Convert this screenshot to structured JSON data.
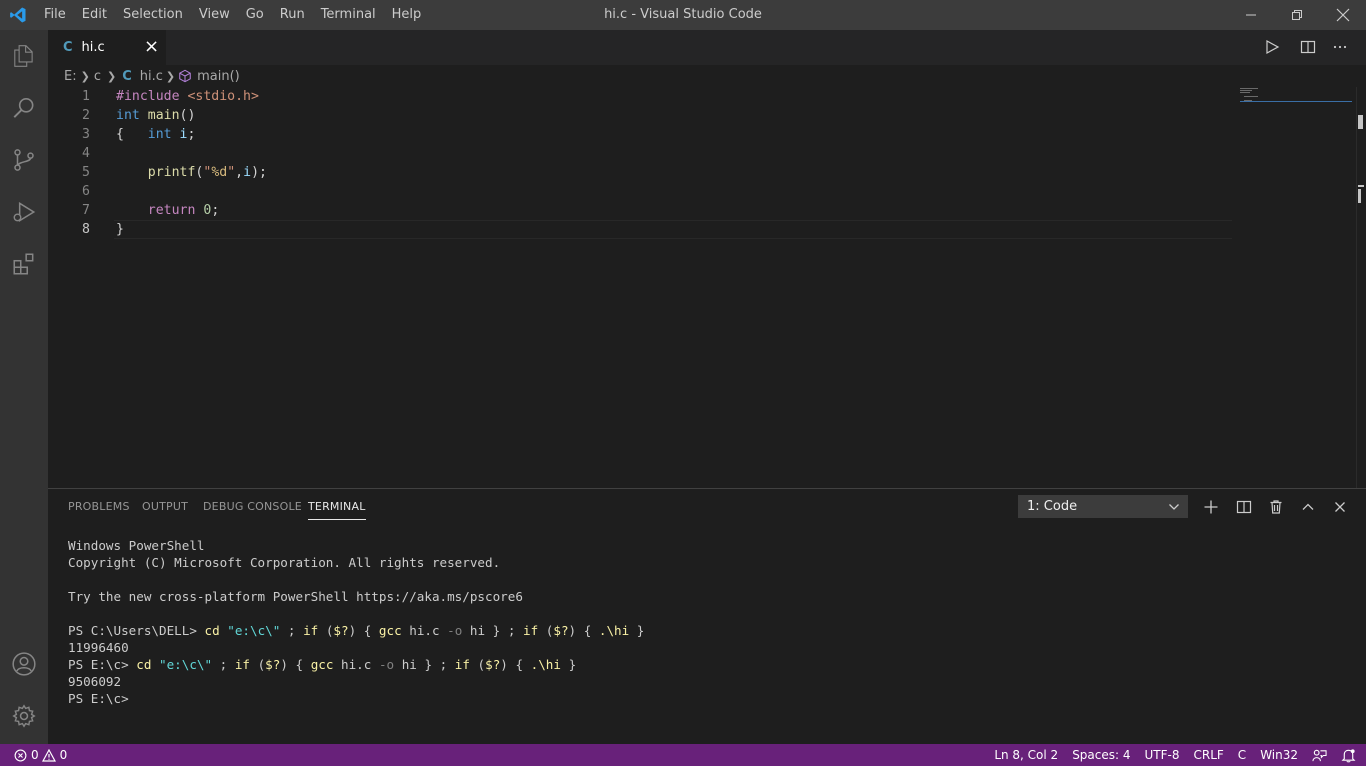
{
  "window": {
    "title": "hi.c - Visual Studio Code",
    "menu": [
      "File",
      "Edit",
      "Selection",
      "View",
      "Go",
      "Run",
      "Terminal",
      "Help"
    ]
  },
  "activity_bar": {
    "icons": [
      "explorer-icon",
      "search-icon",
      "source-control-icon",
      "run-debug-icon",
      "extensions-icon"
    ],
    "bottom_icons": [
      "account-icon",
      "settings-gear-icon"
    ]
  },
  "tabs": [
    {
      "lang_icon": "C",
      "label": "hi.c",
      "close": "×"
    }
  ],
  "breadcrumb": {
    "drive": "E:",
    "folder": "c",
    "file_icon": "C",
    "file": "hi.c",
    "symbol": "main()"
  },
  "editor": {
    "lines": [
      {
        "n": "1",
        "parts": [
          [
            "pp",
            "#include "
          ],
          [
            "str",
            "<stdio.h>"
          ]
        ]
      },
      {
        "n": "2",
        "parts": [
          [
            "kw",
            "int"
          ],
          [
            "",
            " "
          ],
          [
            "fn",
            "main"
          ],
          [
            "",
            "()"
          ]
        ]
      },
      {
        "n": "3",
        "parts": [
          [
            "",
            "{   "
          ],
          [
            "kw",
            "int"
          ],
          [
            "",
            " "
          ],
          [
            "var",
            "i"
          ],
          [
            "",
            ";"
          ]
        ]
      },
      {
        "n": "4",
        "parts": []
      },
      {
        "n": "5",
        "parts": [
          [
            "",
            "    "
          ],
          [
            "fn",
            "printf"
          ],
          [
            "",
            "("
          ],
          [
            "str",
            "\""
          ],
          [
            "ctr",
            "%d"
          ],
          [
            "str",
            "\""
          ],
          [
            "",
            ","
          ],
          [
            "var",
            "i"
          ],
          [
            "",
            ");"
          ]
        ]
      },
      {
        "n": "6",
        "parts": []
      },
      {
        "n": "7",
        "parts": [
          [
            "",
            "    "
          ],
          [
            "kwc",
            "return"
          ],
          [
            "",
            " "
          ],
          [
            "num",
            "0"
          ],
          [
            "",
            ";"
          ]
        ]
      },
      {
        "n": "8",
        "parts": [
          [
            "",
            "}"
          ]
        ]
      }
    ]
  },
  "panel": {
    "tabs": [
      "PROBLEMS",
      "OUTPUT",
      "DEBUG CONSOLE",
      "TERMINAL"
    ],
    "active_tab": "TERMINAL",
    "terminal_select": "1: Code",
    "terminal_lines": [
      [
        [
          "t-w",
          "Windows PowerShell"
        ]
      ],
      [
        [
          "t-w",
          "Copyright (C) Microsoft Corporation. All rights reserved."
        ]
      ],
      [],
      [
        [
          "t-w",
          "Try the new cross-platform PowerShell https://aka.ms/pscore6"
        ]
      ],
      [],
      [
        [
          "t-w",
          "PS C:\\Users\\DELL> "
        ],
        [
          "t-y",
          "cd "
        ],
        [
          "t-b",
          "\"e:\\c\\\""
        ],
        [
          "t-w",
          " ; "
        ],
        [
          "t-y",
          "if"
        ],
        [
          "t-w",
          " ("
        ],
        [
          "t-y",
          "$?"
        ],
        [
          "t-w",
          ") { "
        ],
        [
          "t-y",
          "gcc"
        ],
        [
          "t-w",
          " hi.c "
        ],
        [
          "t-g",
          "-o"
        ],
        [
          "t-w",
          " hi } ; "
        ],
        [
          "t-y",
          "if"
        ],
        [
          "t-w",
          " ("
        ],
        [
          "t-y",
          "$?"
        ],
        [
          "t-w",
          ") { "
        ],
        [
          "t-y",
          ".\\hi"
        ],
        [
          "t-w",
          " }"
        ]
      ],
      [
        [
          "t-w",
          "11996460"
        ]
      ],
      [
        [
          "t-w",
          "PS E:\\c> "
        ],
        [
          "t-y",
          "cd "
        ],
        [
          "t-b",
          "\"e:\\c\\\""
        ],
        [
          "t-w",
          " ; "
        ],
        [
          "t-y",
          "if"
        ],
        [
          "t-w",
          " ("
        ],
        [
          "t-y",
          "$?"
        ],
        [
          "t-w",
          ") { "
        ],
        [
          "t-y",
          "gcc"
        ],
        [
          "t-w",
          " hi.c "
        ],
        [
          "t-g",
          "-o"
        ],
        [
          "t-w",
          " hi } ; "
        ],
        [
          "t-y",
          "if"
        ],
        [
          "t-w",
          " ("
        ],
        [
          "t-y",
          "$?"
        ],
        [
          "t-w",
          ") { "
        ],
        [
          "t-y",
          ".\\hi"
        ],
        [
          "t-w",
          " }"
        ]
      ],
      [
        [
          "t-w",
          "9506092"
        ]
      ],
      [
        [
          "t-w",
          "PS E:\\c>"
        ]
      ]
    ]
  },
  "status_bar": {
    "errors": "0",
    "warnings": "0",
    "position": "Ln 8, Col 2",
    "spaces": "Spaces: 4",
    "encoding": "UTF-8",
    "eol": "CRLF",
    "language": "C",
    "platform": "Win32"
  },
  "colors": {
    "status_bar": "#68217a",
    "title_bar": "#3c3c3c",
    "activity_bar": "#333333",
    "editor_bg": "#1e1e1e"
  }
}
